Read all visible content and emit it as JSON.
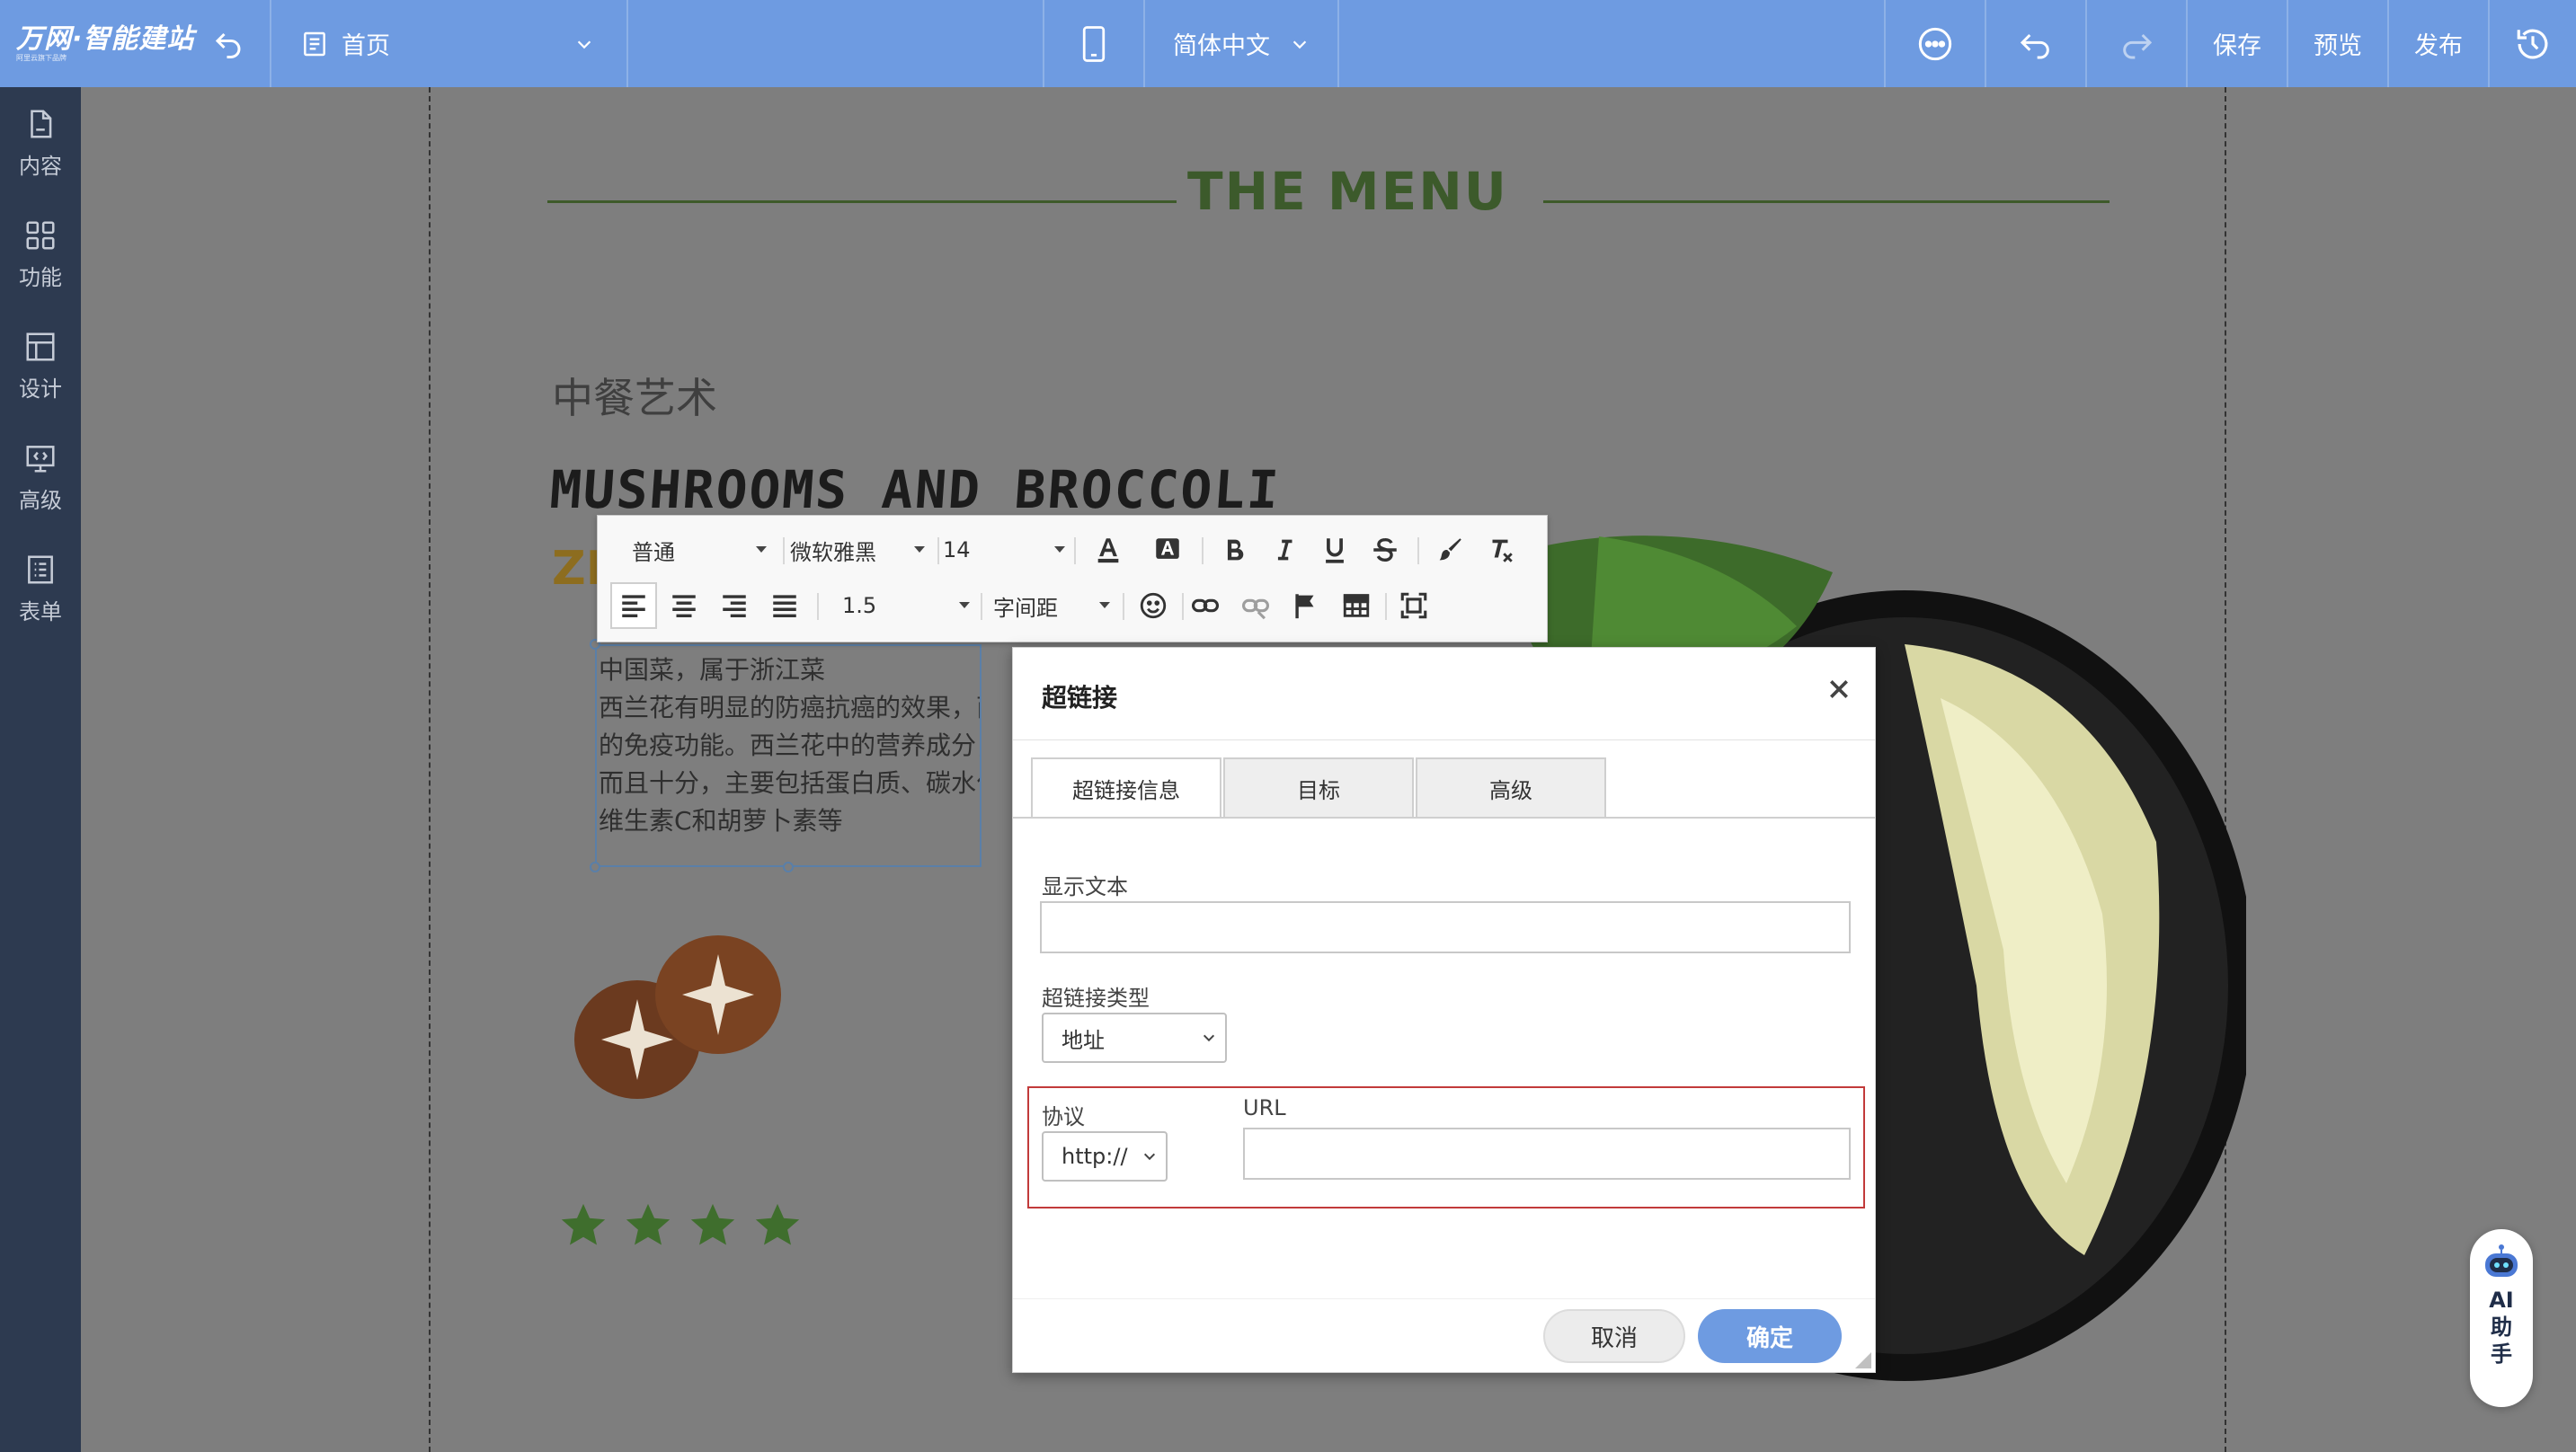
{
  "topbar": {
    "logo_main": "万网·智能建站",
    "logo_sub": "阿里云旗下品牌",
    "page_select": "首页",
    "language_select": "简体中文",
    "save_label": "保存",
    "preview_label": "预览",
    "publish_label": "发布"
  },
  "sidebar": {
    "items": [
      {
        "label": "内容"
      },
      {
        "label": "功能"
      },
      {
        "label": "设计"
      },
      {
        "label": "高级"
      },
      {
        "label": "表单"
      }
    ]
  },
  "canvas": {
    "menu_title": "THE MENU",
    "cn_title": "中餐艺术",
    "en_title": "MUSHROOMS AND BROCCOLI",
    "zh_partial": "ZH",
    "description_lines": [
      "中国菜，属于浙江菜",
      "西兰花有明显的防癌抗癌的效果，西兰",
      "的免疫功能。西兰花中的营养成分，不",
      "而且十分，主要包括蛋白质、碳水化合",
      "维生素C和胡萝卜素等"
    ],
    "star_rating": 4
  },
  "toolbar": {
    "paragraph_format": "普通",
    "font_family": "微软雅黑",
    "font_size": "14",
    "line_height": "1.5",
    "letter_spacing": "字间距"
  },
  "dialog": {
    "title": "超链接",
    "tabs": [
      {
        "label": "超链接信息"
      },
      {
        "label": "目标"
      },
      {
        "label": "高级"
      }
    ],
    "display_text_label": "显示文本",
    "display_text_value": "",
    "link_type_label": "超链接类型",
    "link_type_value": "地址",
    "protocol_label": "协议",
    "protocol_value": "http://",
    "url_label": "URL",
    "url_value": "",
    "cancel_label": "取消",
    "ok_label": "确定"
  },
  "ai_assistant": {
    "label": "AI助手"
  },
  "colors": {
    "topbar": "#6e9be1",
    "sidebar": "#2d3a50",
    "accent_button": "#6e9be1",
    "highlight_border": "#c23a3a"
  }
}
